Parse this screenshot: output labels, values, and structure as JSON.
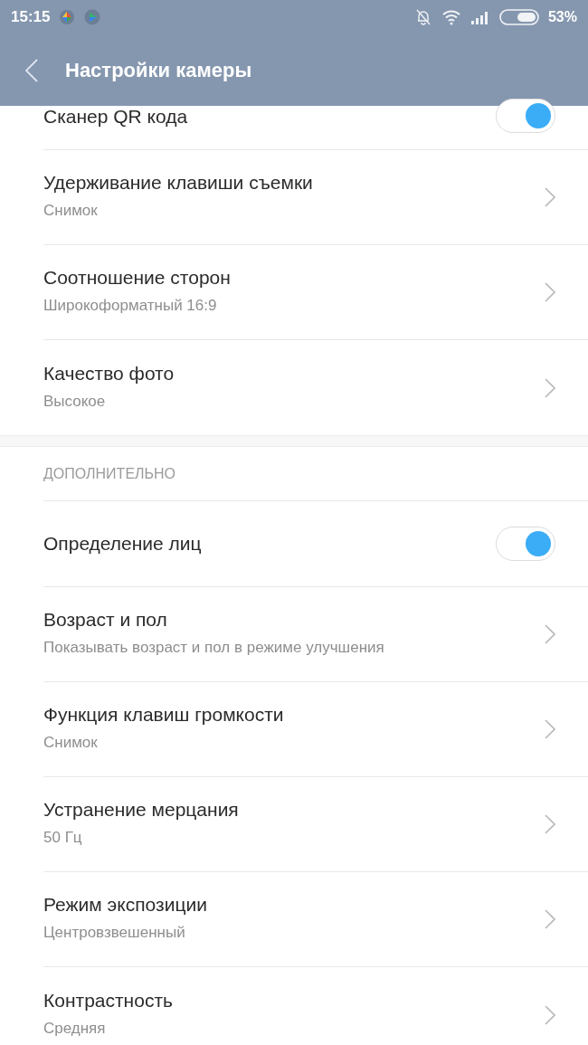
{
  "status_bar": {
    "time": "15:15",
    "battery": "53%"
  },
  "header": {
    "title": "Настройки камеры"
  },
  "sections": [
    {
      "items": [
        {
          "kind": "toggle",
          "title": "Сканер QR кода",
          "on": true
        },
        {
          "kind": "link",
          "title": "Удерживание клавиши съемки",
          "value": "Снимок"
        },
        {
          "kind": "link",
          "title": "Соотношение сторон",
          "value": "Широкоформатный 16:9"
        },
        {
          "kind": "link",
          "title": "Качество фото",
          "value": "Высокое"
        }
      ]
    },
    {
      "heading": "ДОПОЛНИТЕЛЬНО",
      "items": [
        {
          "kind": "toggle",
          "title": "Определение лиц",
          "on": true
        },
        {
          "kind": "link",
          "title": "Возраст и пол",
          "value": "Показывать возраст и пол в режиме улучшения"
        },
        {
          "kind": "link",
          "title": "Функция клавиш громкости",
          "value": "Снимок"
        },
        {
          "kind": "link",
          "title": "Устранение мерцания",
          "value": "50 Гц"
        },
        {
          "kind": "link",
          "title": "Режим экспозиции",
          "value": "Центровзвешенный"
        },
        {
          "kind": "link",
          "title": "Контрастность",
          "value": "Средняя"
        }
      ]
    }
  ]
}
